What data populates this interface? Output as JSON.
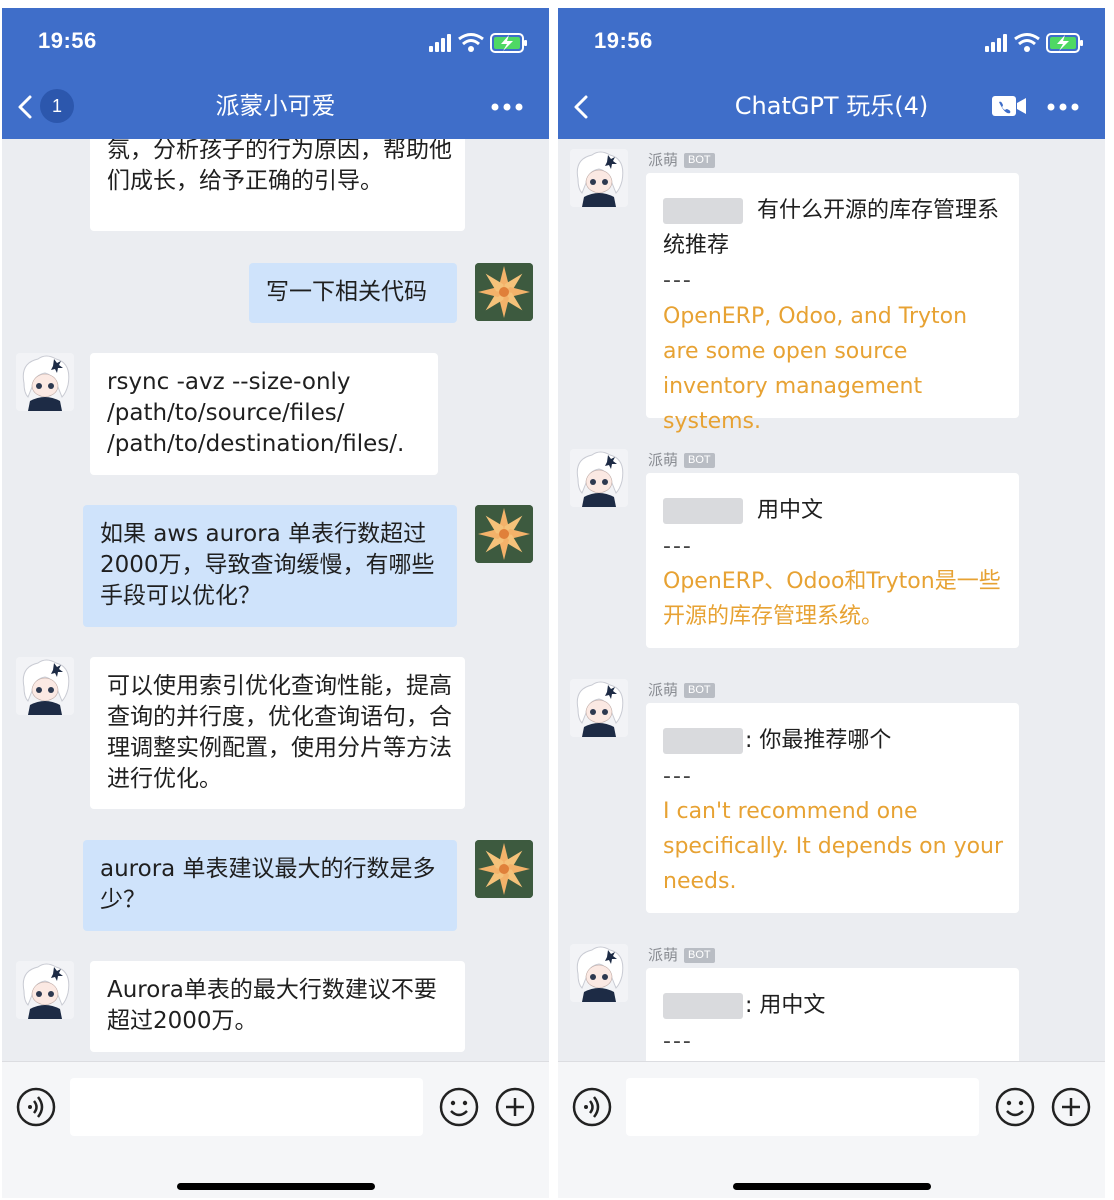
{
  "status_time": "19:56",
  "left": {
    "badge": "1",
    "title": "派蒙小可爱",
    "messages": [
      "氛，分析孩子的行为原因，帮助他们成长，给予正确的引导。",
      "写一下相关代码",
      "rsync -avz --size-only /path/to/source/files/ /path/to/destination/files/.",
      "如果 aws aurora 单表行数超过2000万，导致查询缓慢，有哪些手段可以优化？",
      "可以使用索引优化查询性能，提高查询的并行度，优化查询语句，合理调整实例配置，使用分片等方法进行优化。",
      "aurora 单表建议最大的行数是多少？",
      "Aurora单表的最大行数建议不要超过2000万。"
    ]
  },
  "right": {
    "title": "ChatGPT 玩乐(4)",
    "sender": "派萌",
    "bot_tag": "BOT",
    "separator": "---",
    "cards": [
      {
        "question": "有什么开源的库存管理系统推荐",
        "answer": "OpenERP, Odoo, and Tryton are some open source inventory management systems."
      },
      {
        "question": "用中文",
        "answer": "OpenERP、Odoo和Tryton是一些开源的库存管理系统。"
      },
      {
        "question": ": 你最推荐哪个",
        "answer": "I can't recommend one specifically. It depends on your needs."
      },
      {
        "question": ": 用中文",
        "answer": ""
      }
    ]
  },
  "colors": {
    "header": "#3f6ec9",
    "chat_bg": "#ebedf1",
    "bubble_out": "#cfe3fb",
    "gpt_answer": "#e7a233"
  },
  "icons": [
    "back-icon",
    "more-icon",
    "video-call-icon",
    "voice-icon",
    "emoji-icon",
    "plus-icon",
    "signal-icon",
    "wifi-icon",
    "battery-icon"
  ]
}
